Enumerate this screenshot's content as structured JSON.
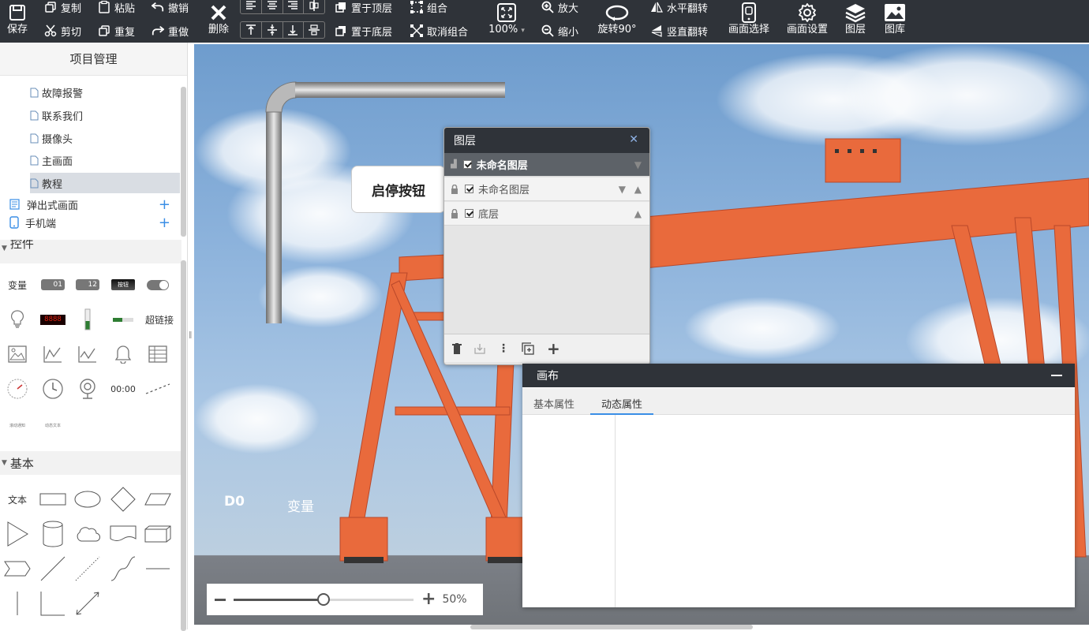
{
  "toolbar": {
    "save": "保存",
    "copy": "复制",
    "cut": "剪切",
    "paste": "粘贴",
    "repeat": "重复",
    "undo": "撤销",
    "redo": "重做",
    "delete": "删除",
    "bring_top": "置于顶层",
    "send_bottom": "置于底层",
    "group": "组合",
    "ungroup": "取消组合",
    "zoom_level": "100%",
    "zoom_in": "放大",
    "zoom_out": "缩小",
    "rotate": "旋转90°",
    "flip_h": "水平翻转",
    "flip_v": "竖直翻转",
    "screen_select": "画面选择",
    "screen_settings": "画面设置",
    "layers": "图层",
    "gallery": "图库"
  },
  "sidebar": {
    "title": "项目管理",
    "pages": [
      "故障报警",
      "联系我们",
      "摄像头",
      "主画面",
      "教程"
    ],
    "groups": [
      "弹出式画面",
      "手机端"
    ],
    "controls_section": "控件",
    "basic_section": "基本",
    "ctl_variable": "变量",
    "ctl_hyperlink": "超链接",
    "ctl_time": "00:00",
    "ctl_counter": "01",
    "ctl_num": "12",
    "ctl_button": "按钮",
    "ctl_digits": "8888",
    "ctl_small1": "滚动通知",
    "ctl_small2": "动态文本",
    "shape_text": "文本"
  },
  "canvas": {
    "button_label": "启停按钮",
    "tag_d0": "D0",
    "tag_var": "变量"
  },
  "zoom": {
    "value": "50%",
    "fraction": 0.5
  },
  "layers_panel": {
    "title": "图层",
    "rows": [
      "未命名图层",
      "未命名图层",
      "底层"
    ]
  },
  "props_panel": {
    "title": "画布",
    "tab_basic": "基本属性",
    "tab_dynamic": "动态属性"
  },
  "colors": {
    "toolbar_bg": "#2f3339",
    "accent": "#3a8ee6",
    "crane": "#e96a3c"
  }
}
